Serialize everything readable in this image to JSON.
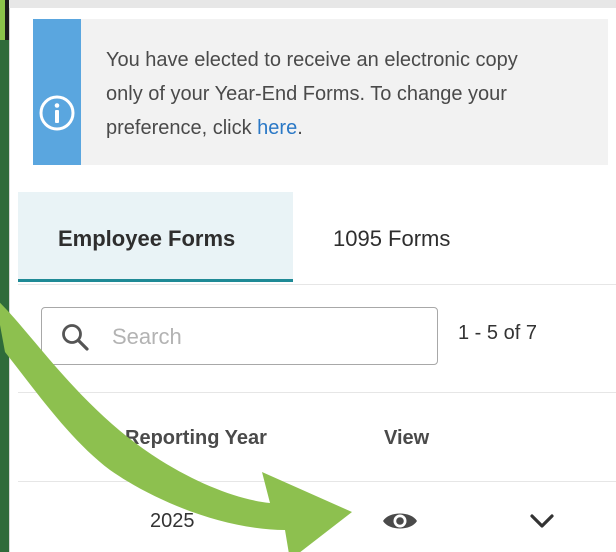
{
  "notice": {
    "line1": "You have elected to receive an electronic copy",
    "line2": "only of your Year-End Forms. To change your",
    "line3_prefix": "preference, click ",
    "link_text": "here",
    "line3_suffix": "."
  },
  "tabs": [
    {
      "label": "Employee Forms",
      "active": true
    },
    {
      "label": "1095 Forms",
      "active": false
    }
  ],
  "search": {
    "placeholder": "Search",
    "value": ""
  },
  "pager": {
    "text": "1 - 5 of 7"
  },
  "table": {
    "headers": [
      "Reporting Year",
      "View"
    ],
    "rows": [
      {
        "year": "2025"
      }
    ]
  },
  "icons": {
    "info": "info-circle-icon",
    "search": "search-icon",
    "view": "eye-icon",
    "expand": "chevron-down-icon",
    "annotation": "green-arrow-annotation"
  },
  "colors": {
    "notice_strip": "#5aa6df",
    "active_tab_bg": "#e9f3f6",
    "active_tab_border": "#1f8a96",
    "link": "#2a78c6",
    "arrow": "#8dc04f"
  }
}
